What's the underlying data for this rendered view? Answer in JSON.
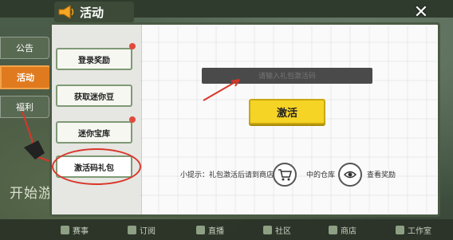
{
  "outer_tabs": {
    "notice": "公告",
    "activity": "活动",
    "other": "福利"
  },
  "background": {
    "start_text": "开始游"
  },
  "panel": {
    "title": "活动",
    "close_symbol": "✕",
    "menu": [
      {
        "label": "登录奖励"
      },
      {
        "label": "获取迷你豆"
      },
      {
        "label": "迷你宝库"
      },
      {
        "label": "激活码礼包"
      }
    ],
    "code_input_placeholder": "请输入礼包激活码",
    "activate_label": "激活",
    "hint_prefix": "小提示：礼包激活后请到商店",
    "hint_mid": "中的仓库",
    "hint_suffix": "查看奖励"
  },
  "bottom_bar": [
    {
      "label": "赛事"
    },
    {
      "label": "订阅"
    },
    {
      "label": "直播"
    },
    {
      "label": "社区"
    },
    {
      "label": "商店"
    },
    {
      "label": "工作室"
    }
  ],
  "colors": {
    "accent_orange": "#e07a1e",
    "activate_yellow": "#f5d425",
    "annotation_red": "#d9362a",
    "panel_dark": "#3c4a37"
  }
}
